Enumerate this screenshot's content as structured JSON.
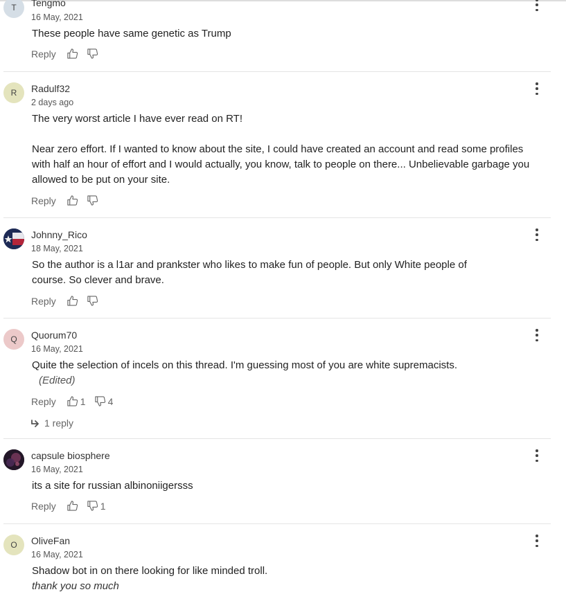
{
  "reply_label": "Reply",
  "comments": [
    {
      "user": "Tengmo",
      "initial": "T",
      "date": "16 May, 2021",
      "text": [
        "These people have same genetic as Trump"
      ]
    },
    {
      "user": "Radulf32",
      "initial": "R",
      "date": "2 days ago",
      "text": [
        "The very worst article I have ever read on RT!",
        "Near zero effort. If I wanted to know about the site, I could have created an account and read some profiles with half an hour of effort and I would actually, you know, talk to people on there... Unbelievable garbage you allowed to be put on your site."
      ]
    },
    {
      "user": "Johnny_Rico",
      "date": "18 May, 2021",
      "text": [
        "So the author is a l1ar and prankster who likes to make fun of people. But only White people of course. So clever and brave."
      ]
    },
    {
      "user": "Quorum70",
      "initial": "Q",
      "date": "16 May, 2021",
      "text": [
        "Quite the selection of incels on this thread. I'm guessing most of you are white supremacists."
      ],
      "edited": "(Edited)",
      "likes": "1",
      "dislikes": "4",
      "replies": "1 reply"
    },
    {
      "user": "capsule biosphere",
      "date": "16 May, 2021",
      "text": [
        "its a site for russian albinoniigersss"
      ],
      "dislikes": "1"
    },
    {
      "user": "OliveFan",
      "initial": "O",
      "date": "16 May, 2021",
      "text": [
        "Shadow bot in on there looking for like minded troll."
      ],
      "tail": "thank you so much"
    }
  ],
  "colors": {
    "avatar_t": "#d5dee6",
    "avatar_r": "#e4e4bd",
    "avatar_q": "#ecc9c9",
    "avatar_o": "#e4e4bd",
    "divider": "#e4e4e4"
  },
  "icons": [
    "thumbs-up-icon",
    "thumbs-down-icon",
    "kebab-menu-icon",
    "reply-arrow-icon"
  ]
}
